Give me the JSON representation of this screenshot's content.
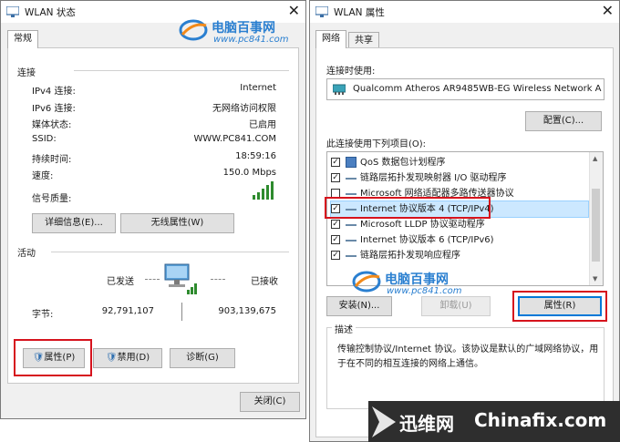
{
  "left_window": {
    "title": "WLAN 状态",
    "close": "✕",
    "tab": "常规",
    "connection_section": "连接",
    "rows": [
      {
        "label": "IPv4 连接:",
        "value": "Internet"
      },
      {
        "label": "IPv6 连接:",
        "value": "无网络访问权限"
      },
      {
        "label": "媒体状态:",
        "value": "已启用"
      },
      {
        "label": "SSID:",
        "value": "WWW.PC841.COM"
      },
      {
        "label": "持续时间:",
        "value": "18:59:16"
      },
      {
        "label": "速度:",
        "value": "150.0 Mbps"
      },
      {
        "label": "信号质量:",
        "value": ""
      }
    ],
    "signal_level": 5,
    "details_button": "详细信息(E)...",
    "wireless_props_button": "无线属性(W)",
    "activity_section": "活动",
    "sent_label": "已发送",
    "received_label": "已接收",
    "bytes_label": "字节:",
    "sent_bytes": "92,791,107",
    "received_bytes": "903,139,675",
    "properties_button": "属性(P)",
    "disable_button": "禁用(D)",
    "diagnose_button": "诊断(G)",
    "close_button": "关闭(C)"
  },
  "right_window": {
    "title": "WLAN 属性",
    "close": "✕",
    "tabs": [
      "网络",
      "共享"
    ],
    "connect_using_label": "连接时使用:",
    "adapter_name": "Qualcomm Atheros AR9485WB-EG Wireless Network A",
    "configure_button": "配置(C)...",
    "items_label": "此连接使用下列项目(O):",
    "items": [
      {
        "label": "QoS 数据包计划程序",
        "checked": true
      },
      {
        "label": "链路层拓扑发现映射器 I/O 驱动程序",
        "checked": true
      },
      {
        "label": "Microsoft 网络适配器多路传送器协议",
        "checked": false
      },
      {
        "label": "Internet 协议版本 4 (TCP/IPv4)",
        "checked": true,
        "selected": true
      },
      {
        "label": "Microsoft LLDP 协议驱动程序",
        "checked": true
      },
      {
        "label": "Internet 协议版本 6 (TCP/IPv6)",
        "checked": true
      },
      {
        "label": "链路层拓扑发现响应程序",
        "checked": true
      }
    ],
    "install_button": "安装(N)...",
    "uninstall_button": "卸载(U)",
    "properties_button": "属性(R)",
    "description_title": "描述",
    "description_text_1": "传输控制协议/Internet 协议。该协议是默认的广域网络协议，用",
    "description_text_2": "于在不同的相互连接的网络上通信。"
  },
  "watermarks": {
    "site_name": "电脑百事网",
    "site_url": "www.pc841.com",
    "brand_1": "迅维网",
    "brand_2": "Chinafix.com"
  },
  "colors": {
    "highlight_red": "#d6131d",
    "watermark_blue": "#2a7fd0",
    "watermark_orange": "#f28a1a",
    "banner_bg": "#2e2e2e"
  }
}
